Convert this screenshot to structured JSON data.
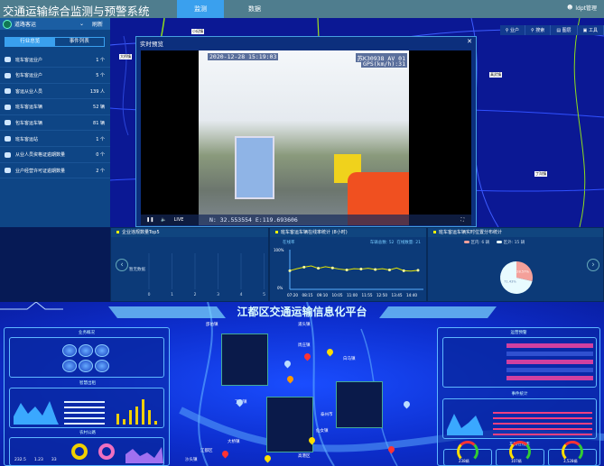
{
  "header": {
    "title": "交通运输综合监测与预警系统",
    "tabs": [
      {
        "label": "监测",
        "active": true
      },
      {
        "label": "数据",
        "active": false
      }
    ],
    "user": "ldpt管理"
  },
  "left_panel": {
    "category": "道路客运",
    "refresh": "刷新",
    "tabs": [
      "行业总览",
      "事件列表"
    ],
    "items": [
      {
        "label": "班车客运业户",
        "value": "1 个"
      },
      {
        "label": "包车客运业户",
        "value": "5 个"
      },
      {
        "label": "客运从业人员",
        "value": "139 人"
      },
      {
        "label": "班车客运车辆",
        "value": "52 辆"
      },
      {
        "label": "包车客运车辆",
        "value": "81 辆"
      },
      {
        "label": "班车客运站",
        "value": "1 个"
      },
      {
        "label": "从业人员资格证逾期数量",
        "value": "0 个"
      },
      {
        "label": "业户经营许可证逾期数量",
        "value": "2 个"
      }
    ]
  },
  "map": {
    "toolbar": [
      "业户",
      "搜索",
      "图层",
      "工具"
    ],
    "labels": [
      "大桥镇",
      "小纪镇",
      "武坚镇",
      "宜陵镇",
      "樊川镇",
      "真武镇",
      "丁沟镇",
      "仙女镇"
    ]
  },
  "video": {
    "title": "实时预览",
    "timestamp": "2020-12-28  15:19:03",
    "plate": "苏K30938  AV 01",
    "gps": "GPS(km/h):31",
    "coords": "N: 32.553554  E:119.693606",
    "live": "LIVE"
  },
  "charts": [
    {
      "title": "企业违规数量Top5",
      "type": "bar",
      "empty_text": "暂无数据",
      "x_ticks": [
        "0",
        "1",
        "2",
        "3",
        "4",
        "5"
      ]
    },
    {
      "title": "班车客运车辆在线率统计 (8小时)",
      "type": "line",
      "ylabel": "在线率",
      "total_label": "车辆总数: 52",
      "online_label": "在线数量: 21",
      "y_ticks": [
        "100%",
        "0%"
      ],
      "ylim": [
        0,
        100
      ],
      "categories": [
        "07:20",
        "08:15",
        "09:10",
        "10:05",
        "11:00",
        "11:55",
        "12:50",
        "13:45",
        "14:40"
      ],
      "values": [
        47,
        52,
        56,
        59,
        53,
        57,
        54,
        51,
        49,
        52,
        51,
        53,
        50,
        52,
        49,
        54,
        47,
        46,
        48
      ],
      "line_color": "#e5e500"
    },
    {
      "title": "班车客运车辆实时位置分布统计",
      "type": "pie",
      "series": [
        {
          "name": "区内: 6 辆",
          "value": 28.57,
          "color": "#f4a09a",
          "label": "28.57%"
        },
        {
          "name": "区外: 15 辆",
          "value": 71.43,
          "color": "#e8fbff",
          "label": "71.43%"
        }
      ]
    }
  ],
  "dashboard": {
    "title": "江都区交通运输信息化平台",
    "left_sections": [
      "业务概况",
      "智慧出租",
      "农村公路"
    ],
    "right_sections": [
      "运营预警",
      "事件统计",
      "车辆在线率"
    ],
    "map_labels": [
      "邵伯镇",
      "浦头镇",
      "周庄镇",
      "大桥镇",
      "丁沟镇",
      "江都区",
      "樊川镇",
      "仙女镇",
      "高港区",
      "沙头镇",
      "白马镇",
      "泰州市"
    ],
    "left_numbers": [
      "232.5",
      "1.23",
      "33"
    ],
    "gauges": [
      "238辆",
      "107辆",
      "3,528辆"
    ]
  },
  "colors": {
    "accent": "#3aa0ee",
    "panel": "#0e4585",
    "map": "#0b1894"
  }
}
